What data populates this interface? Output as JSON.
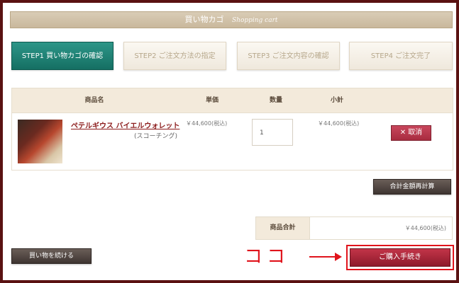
{
  "header": {
    "title": "買い物カゴ",
    "subtitle": "Shopping cart"
  },
  "steps": [
    {
      "label": "STEP1 買い物カゴの確認"
    },
    {
      "label": "STEP2 ご注文方法の指定"
    },
    {
      "label": "STEP3 ご注文内容の確認"
    },
    {
      "label": "STEP4 ご注文完了"
    }
  ],
  "cart": {
    "columns": {
      "product": "商品名",
      "unit_price": "単価",
      "quantity": "数量",
      "subtotal": "小計"
    },
    "items": [
      {
        "name": "ペテルギウス バイエルウォレット",
        "variant": "(スコーチング)",
        "unit_price": "￥44,600(税込)",
        "quantity": "1",
        "subtotal": "￥44,600(税込)",
        "delete_label": "取消"
      }
    ]
  },
  "actions": {
    "recalc_label": "合計金額再計算",
    "continue_label": "買い物を続ける",
    "purchase_label": "ご購入手続き"
  },
  "total": {
    "label": "商品合計",
    "value": "￥44,600(税込)"
  },
  "annotation": {
    "text": "ココ"
  },
  "colors": {
    "accent_red": "#e0141c",
    "step_active": "#1f7f73",
    "brand_dark": "#5a1212"
  }
}
